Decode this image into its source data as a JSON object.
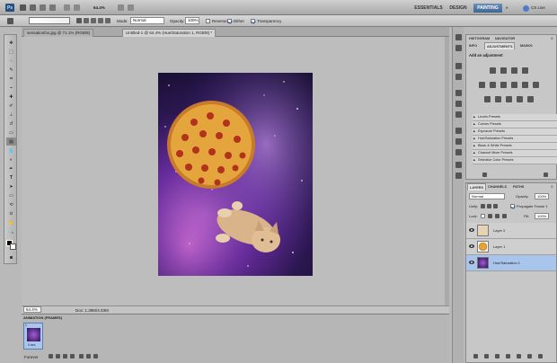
{
  "app": {
    "workspaces": [
      "ESSENTIALS",
      "DESIGN",
      "PAINTING"
    ],
    "active_workspace": "PAINTING",
    "cs_live": "CS Live",
    "zoom_menu": "64.4%"
  },
  "options": {
    "mode_label": "Mode:",
    "mode_value": "Normal",
    "opacity_label": "Opacity:",
    "opacity_value": "100%",
    "reverse_label": "Reverse",
    "dither_label": "Dither",
    "transparency_label": "Transparency"
  },
  "docs": [
    {
      "title": "sensationfox.jpg @ 71.1% (RGB/8)"
    },
    {
      "title": "Untitled-1 @ 64.4% (Hue/Saturation 1, RGB/8) *"
    }
  ],
  "status": {
    "zoom": "64.4%",
    "doc": "Doc: 1.39M/4.03M"
  },
  "animation": {
    "title": "ANIMATION (FRAMES)",
    "frame_time": "0 sec.",
    "loop": "Forever",
    "frame_number": "1"
  },
  "adjustments_panel": {
    "tabs": [
      "HISTOGRAM",
      "NAVIGATOR",
      "INFO",
      "ADJUSTMENTS",
      "MASKS"
    ],
    "active_tab": "ADJUSTMENTS",
    "title": "Add an adjustment",
    "presets": [
      "Levels Presets",
      "Curves Presets",
      "Exposure Presets",
      "Hue/Saturation Presets",
      "Black & White Presets",
      "Channel Mixer Presets",
      "Selective Color Presets"
    ]
  },
  "layers_panel": {
    "tabs": [
      "LAYERS",
      "CHANNELS",
      "PATHS"
    ],
    "active_tab": "LAYERS",
    "blend_mode": "Normal",
    "opacity_label": "Opacity:",
    "opacity_value": "100%",
    "unify_label": "Unify:",
    "propagate_label": "Propagate Frame 1",
    "lock_label": "Lock:",
    "fill_label": "Fill:",
    "fill_value": "100%",
    "layers": [
      {
        "name": "Layer 2"
      },
      {
        "name": "Layer 1"
      },
      {
        "name": "Hue/Saturation 1"
      }
    ],
    "selected_index": 2
  },
  "colors": {
    "accent": "#3f6593",
    "selection": "#a9c5ec"
  }
}
